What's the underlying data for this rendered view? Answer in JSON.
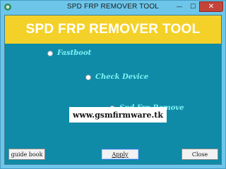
{
  "window": {
    "title": "SPD FRP REMOVER TOOL",
    "close_glyph": "✕",
    "minimize_glyph": "—",
    "maximize_glyph": "☐"
  },
  "banner": {
    "text": "SPD FRP REMOVER TOOL",
    "bg_color": "#f4d128"
  },
  "options": [
    {
      "label": "Fastboot",
      "checked": false
    },
    {
      "label": "Check Device",
      "checked": false
    },
    {
      "label": "Spd Frp Remove",
      "checked": true
    }
  ],
  "website": "www.gsmfirmware.tk",
  "buttons": {
    "guide": "guide book",
    "apply": "Apply",
    "close": "Close"
  },
  "colors": {
    "client_bg": "#0f8aa7",
    "frame": "#6dc6ea",
    "option_text": "#7ef4f4"
  }
}
